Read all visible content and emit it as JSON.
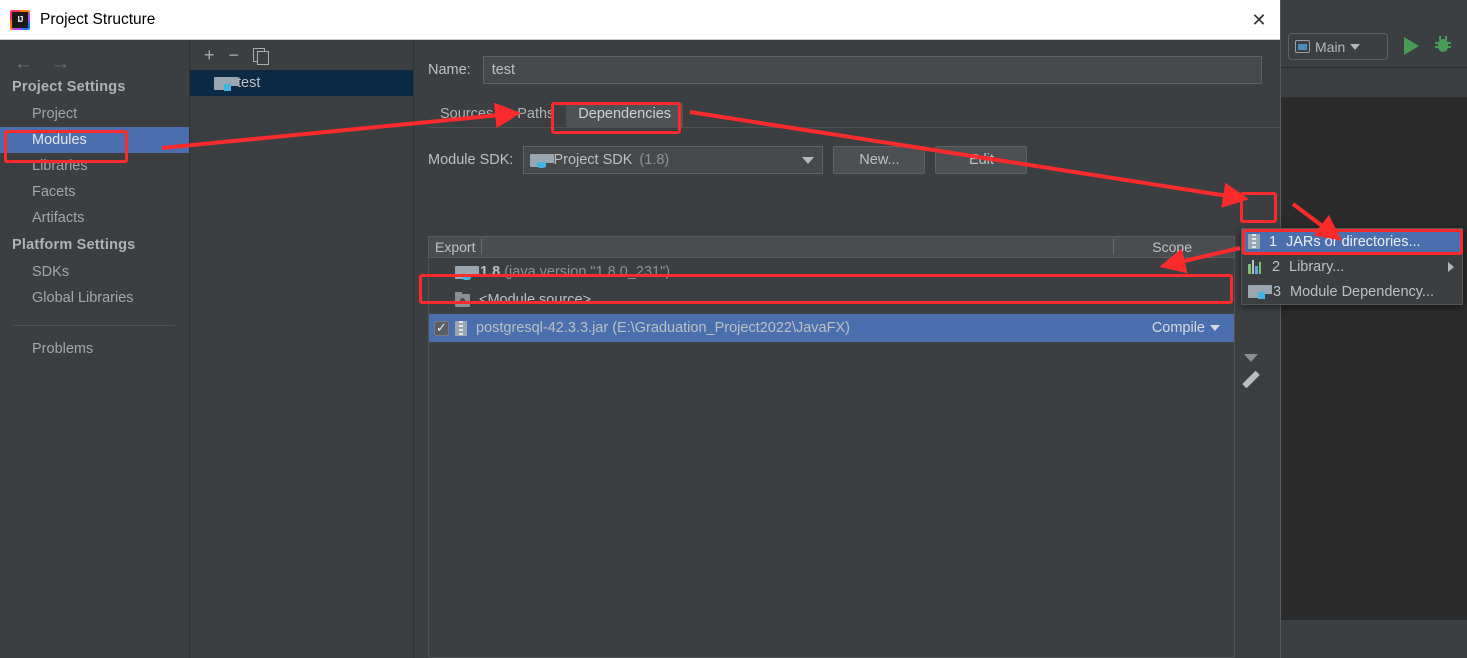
{
  "dialog": {
    "title": "Project Structure",
    "logo_icon": "intellij-idea-logo",
    "close_icon": "close-icon"
  },
  "sidebar": {
    "back_icon": "arrow-left-icon",
    "forward_icon": "arrow-right-icon",
    "groups": [
      {
        "title": "Project Settings",
        "items": [
          {
            "label": "Project",
            "selected": false
          },
          {
            "label": "Modules",
            "selected": true
          },
          {
            "label": "Libraries",
            "selected": false
          },
          {
            "label": "Facets",
            "selected": false
          },
          {
            "label": "Artifacts",
            "selected": false
          }
        ]
      },
      {
        "title": "Platform Settings",
        "items": [
          {
            "label": "SDKs",
            "selected": false
          },
          {
            "label": "Global Libraries",
            "selected": false
          }
        ]
      }
    ],
    "problems_label": "Problems"
  },
  "module_list": {
    "toolbar": {
      "add_label": "+",
      "remove_label": "−",
      "copy_icon": "copy-icon"
    },
    "modules": [
      {
        "label": "test",
        "icon": "module-folder-icon",
        "selected": true
      }
    ]
  },
  "content": {
    "name_label": "Name:",
    "name_value": "test",
    "tabs": [
      {
        "label": "Sources",
        "active": false
      },
      {
        "label": "Paths",
        "active": false
      },
      {
        "label": "Dependencies",
        "active": true
      }
    ],
    "sdk_label": "Module SDK:",
    "sdk_value": "Project SDK",
    "sdk_value_suffix": "(1.8)",
    "sdk_icon": "java-sdk-folder-icon",
    "new_button": "New...",
    "edit_button": "Edit",
    "table": {
      "col_export": "Export",
      "col_scope": "Scope",
      "rows": [
        {
          "checkbox": null,
          "icon": "java-sdk-folder-icon",
          "name": "1.8",
          "name_suffix": "(java version \"1.8.0_231\")",
          "scope": null,
          "selected": false
        },
        {
          "checkbox": null,
          "icon": "module-source-icon",
          "name": "<Module source>",
          "name_suffix": "",
          "scope": null,
          "selected": false
        },
        {
          "checkbox": true,
          "icon": "jar-icon",
          "name": "postgresql-42.3.3.jar",
          "name_suffix": "(E:\\Graduation_Project2022\\JavaFX)",
          "scope": "Compile",
          "selected": true
        }
      ]
    },
    "dep_toolbar": {
      "add_label": "+",
      "down_icon": "chevron-down-icon",
      "edit_icon": "pencil-icon"
    }
  },
  "popup_menu": {
    "items": [
      {
        "num": "1",
        "label": "JARs or directories...",
        "icon": "jar-icon",
        "selected": true,
        "submenu": false
      },
      {
        "num": "2",
        "label": "Library...",
        "icon": "library-icon",
        "selected": false,
        "submenu": true
      },
      {
        "num": "3",
        "label": "Module Dependency...",
        "icon": "module-folder-icon",
        "selected": false,
        "submenu": false
      }
    ]
  },
  "ide": {
    "run_config": "Main",
    "run_config_icon": "run-configuration-icon",
    "run_icon": "run-play-icon",
    "debug_icon": "debug-bug-icon"
  },
  "annotations": {
    "highlight_color": "#fb2b2b",
    "boxes": [
      "modules-sidebar-item",
      "dependencies-tab",
      "jar-row",
      "add-dependency-button",
      "jars-or-directories-menu-item"
    ],
    "arrows": 4
  }
}
